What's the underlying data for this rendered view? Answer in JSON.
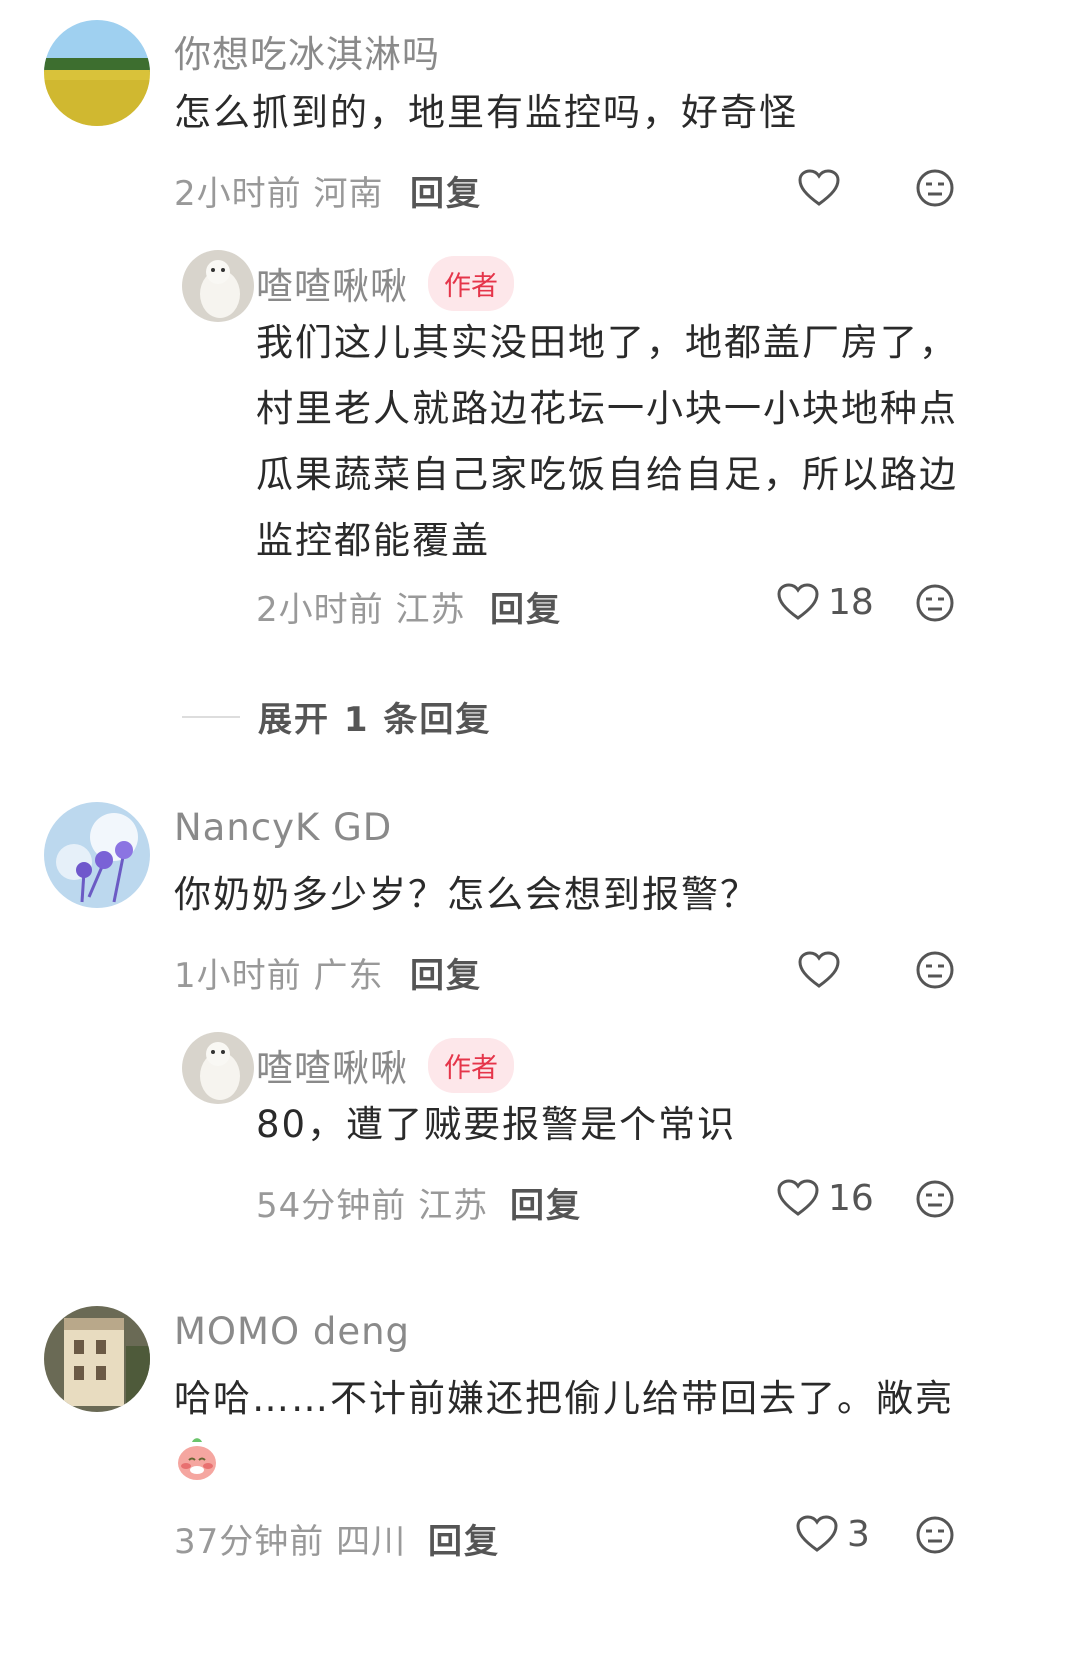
{
  "comments": [
    {
      "user": "你想吃冰淇淋吗",
      "text": "怎么抓到的，地里有监控吗，好奇怪",
      "time": "2小时前",
      "location": "河南",
      "reply_label": "回复",
      "likes": "",
      "replies": [
        {
          "user": "喳喳啾啾",
          "badge": "作者",
          "text_lines": [
            "我们这儿其实没田地了，地都盖厂房了，",
            "村里老人就路边花坛一小块一小块地种点",
            "瓜果蔬菜自己家吃饭自给自足，所以路边",
            "监控都能覆盖"
          ],
          "time": "2小时前",
          "location": "江苏",
          "reply_label": "回复",
          "likes": "18"
        }
      ],
      "expand_label": "展开 1 条回复"
    },
    {
      "user": "NancyK GD",
      "text": "你奶奶多少岁？怎么会想到报警？",
      "time": "1小时前",
      "location": "广东",
      "reply_label": "回复",
      "likes": "",
      "replies": [
        {
          "user": "喳喳啾啾",
          "badge": "作者",
          "text_lines": [
            "80，遭了贼要报警是个常识"
          ],
          "time": "54分钟前",
          "location": "江苏",
          "reply_label": "回复",
          "likes": "16"
        }
      ]
    },
    {
      "user": "MOMO deng",
      "text": "哈哈……不计前嫌还把偷儿给带回去了。敞亮",
      "time": "37分钟前",
      "location": "四川",
      "reply_label": "回复",
      "likes": "3",
      "replies": []
    }
  ],
  "colors": {
    "author_badge_bg": "#fde7ea",
    "author_badge_text": "#e5354a",
    "meta_text": "#999999",
    "name_text": "#8a8a8a"
  }
}
